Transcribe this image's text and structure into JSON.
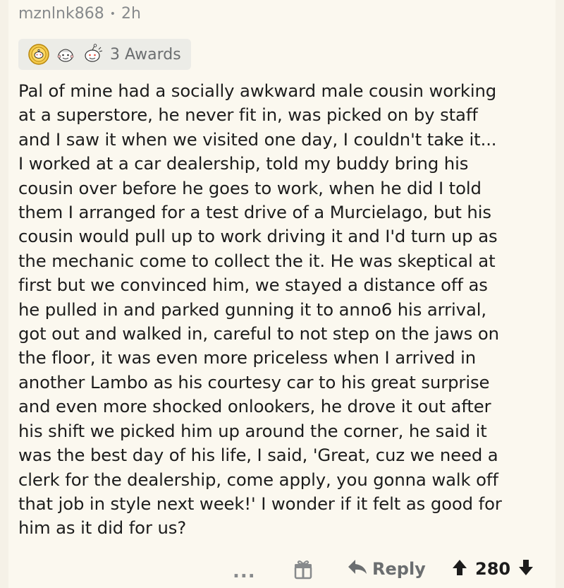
{
  "comment": {
    "username": "mznlnk868",
    "separator": "•",
    "age": "2h",
    "awards_label": "3 Awards",
    "award_icons": [
      "gold-award-icon",
      "wholesome-award-icon",
      "helpful-award-icon"
    ],
    "body": "Pal of mine had a socially awkward male cousin working\nat a superstore, he never fit in, was picked on by staff\nand I saw it when we visited one day, I couldn't take it...\nI worked at a car dealership, told my buddy bring his\ncousin over before he goes to work, when he did I told\nthem I arranged for a test drive of a Murcielago, but his\ncousin would pull up to work driving it and I'd turn up as\nthe mechanic come to collect the it. He was skeptical at\nfirst but we convinced him, we stayed a distance off as\nhe pulled in and parked gunning it to anno6 his arrival,\ngot out and walked in, careful to not step on the jaws on\nthe floor, it was even more priceless when I arrived in\nanother Lambo as his courtesy car to his great surprise\nand even more shocked onlookers, he drove it out after\nhis shift we picked him up around the corner, he said it\nwas the best day of his life, I said, 'Great, cuz we need a\nclerk for the dealership, come apply, you gonna walk off\nthat job in style next week!' I wonder if it felt as good for\nhim as it did for us?"
  },
  "actions": {
    "more_label": "...",
    "reply_label": "Reply",
    "score": "280"
  },
  "colors": {
    "background": "#f5f1e7",
    "card": "#fbf8ef",
    "muted_text": "#878a8c",
    "award_pill": "#ecece7"
  }
}
